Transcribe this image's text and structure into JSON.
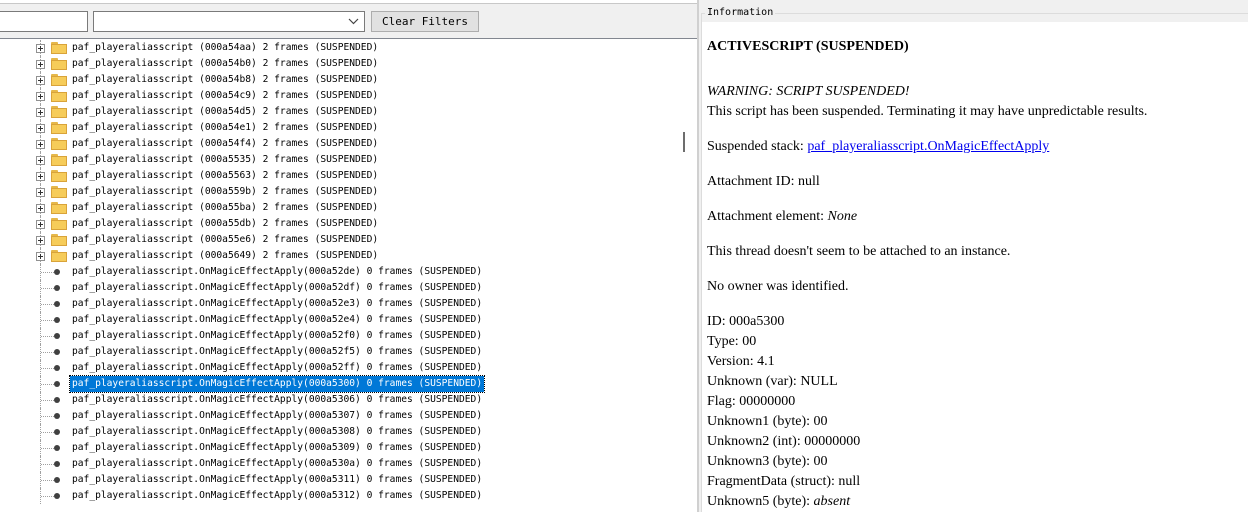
{
  "filter": {
    "text_value": "",
    "combo_value": "",
    "clear_label": "Clear Filters"
  },
  "tree": {
    "items": [
      {
        "label": "paf_playeraliasscript (000a54aa) 2 frames (SUSPENDED)",
        "kind": "folder"
      },
      {
        "label": "paf_playeraliasscript (000a54b0) 2 frames (SUSPENDED)",
        "kind": "folder"
      },
      {
        "label": "paf_playeraliasscript (000a54b8) 2 frames (SUSPENDED)",
        "kind": "folder"
      },
      {
        "label": "paf_playeraliasscript (000a54c9) 2 frames (SUSPENDED)",
        "kind": "folder"
      },
      {
        "label": "paf_playeraliasscript (000a54d5) 2 frames (SUSPENDED)",
        "kind": "folder"
      },
      {
        "label": "paf_playeraliasscript (000a54e1) 2 frames (SUSPENDED)",
        "kind": "folder"
      },
      {
        "label": "paf_playeraliasscript (000a54f4) 2 frames (SUSPENDED)",
        "kind": "folder"
      },
      {
        "label": "paf_playeraliasscript (000a5535) 2 frames (SUSPENDED)",
        "kind": "folder"
      },
      {
        "label": "paf_playeraliasscript (000a5563) 2 frames (SUSPENDED)",
        "kind": "folder"
      },
      {
        "label": "paf_playeraliasscript (000a559b) 2 frames (SUSPENDED)",
        "kind": "folder"
      },
      {
        "label": "paf_playeraliasscript (000a55ba) 2 frames (SUSPENDED)",
        "kind": "folder"
      },
      {
        "label": "paf_playeraliasscript (000a55db) 2 frames (SUSPENDED)",
        "kind": "folder"
      },
      {
        "label": "paf_playeraliasscript (000a55e6) 2 frames (SUSPENDED)",
        "kind": "folder"
      },
      {
        "label": "paf_playeraliasscript (000a5649) 2 frames (SUSPENDED)",
        "kind": "folder"
      },
      {
        "label": "paf_playeraliasscript.OnMagicEffectApply(000a52de) 0 frames (SUSPENDED)",
        "kind": "leaf"
      },
      {
        "label": "paf_playeraliasscript.OnMagicEffectApply(000a52df) 0 frames (SUSPENDED)",
        "kind": "leaf"
      },
      {
        "label": "paf_playeraliasscript.OnMagicEffectApply(000a52e3) 0 frames (SUSPENDED)",
        "kind": "leaf"
      },
      {
        "label": "paf_playeraliasscript.OnMagicEffectApply(000a52e4) 0 frames (SUSPENDED)",
        "kind": "leaf"
      },
      {
        "label": "paf_playeraliasscript.OnMagicEffectApply(000a52f0) 0 frames (SUSPENDED)",
        "kind": "leaf"
      },
      {
        "label": "paf_playeraliasscript.OnMagicEffectApply(000a52f5) 0 frames (SUSPENDED)",
        "kind": "leaf"
      },
      {
        "label": "paf_playeraliasscript.OnMagicEffectApply(000a52ff) 0 frames (SUSPENDED)",
        "kind": "leaf"
      },
      {
        "label": "paf_playeraliasscript.OnMagicEffectApply(000a5300) 0 frames (SUSPENDED)",
        "kind": "leaf",
        "selected": true
      },
      {
        "label": "paf_playeraliasscript.OnMagicEffectApply(000a5306) 0 frames (SUSPENDED)",
        "kind": "leaf"
      },
      {
        "label": "paf_playeraliasscript.OnMagicEffectApply(000a5307) 0 frames (SUSPENDED)",
        "kind": "leaf"
      },
      {
        "label": "paf_playeraliasscript.OnMagicEffectApply(000a5308) 0 frames (SUSPENDED)",
        "kind": "leaf"
      },
      {
        "label": "paf_playeraliasscript.OnMagicEffectApply(000a5309) 0 frames (SUSPENDED)",
        "kind": "leaf"
      },
      {
        "label": "paf_playeraliasscript.OnMagicEffectApply(000a530a) 0 frames (SUSPENDED)",
        "kind": "leaf"
      },
      {
        "label": "paf_playeraliasscript.OnMagicEffectApply(000a5311) 0 frames (SUSPENDED)",
        "kind": "leaf"
      },
      {
        "label": "paf_playeraliasscript.OnMagicEffectApply(000a5312) 0 frames (SUSPENDED)",
        "kind": "leaf"
      }
    ]
  },
  "info": {
    "group_title": "Information",
    "heading": "ACTIVESCRIPT (SUSPENDED)",
    "warning": "WARNING: SCRIPT SUSPENDED!",
    "warning_detail": "This script has been suspended. Terminating it may have unpredictable results.",
    "stack_label": "Suspended stack: ",
    "stack_link": "paf_playeraliasscript.OnMagicEffectApply",
    "attachment_id": "Attachment ID: null",
    "attachment_element_label": "Attachment element: ",
    "attachment_element_value": "None",
    "thread_note": "This thread doesn't seem to be attached to an instance.",
    "owner_note": "No owner was identified.",
    "fields": [
      {
        "label": "ID: ",
        "value": "000a5300",
        "italic": false
      },
      {
        "label": "Type: ",
        "value": "00",
        "italic": false
      },
      {
        "label": "Version: ",
        "value": "4.1",
        "italic": false
      },
      {
        "label": "Unknown (var): ",
        "value": "NULL",
        "italic": false
      },
      {
        "label": "Flag: ",
        "value": "00000000",
        "italic": false
      },
      {
        "label": "Unknown1 (byte): ",
        "value": "00",
        "italic": false
      },
      {
        "label": "Unknown2 (int): ",
        "value": "00000000",
        "italic": false
      },
      {
        "label": "Unknown3 (byte): ",
        "value": "00",
        "italic": false
      },
      {
        "label": "FragmentData (struct): ",
        "value": "null",
        "italic": false
      },
      {
        "label": "Unknown5 (byte): ",
        "value": "absent",
        "italic": true
      }
    ]
  }
}
